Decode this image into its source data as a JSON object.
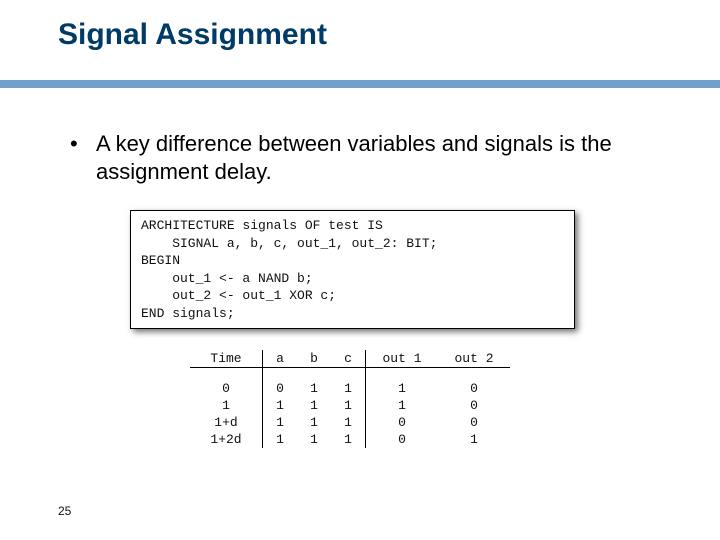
{
  "title": "Signal Assignment",
  "bullet_text": "A key difference between variables and signals is the assignment delay.",
  "code": {
    "l1": "ARCHITECTURE signals OF test IS",
    "l2": "    SIGNAL a, b, c, out_1, out_2: BIT;",
    "l3": "BEGIN",
    "l4": "    out_1 <- a NAND b;",
    "l5": "    out_2 <- out_1 XOR c;",
    "l6": "END signals;"
  },
  "table": {
    "headers": {
      "time": "Time",
      "a": "a",
      "b": "b",
      "c": "c",
      "out1": "out 1",
      "out2": "out 2"
    },
    "rows": [
      {
        "time": "0",
        "a": "0",
        "b": "1",
        "c": "1",
        "out1": "1",
        "out2": "0"
      },
      {
        "time": "1",
        "a": "1",
        "b": "1",
        "c": "1",
        "out1": "1",
        "out2": "0"
      },
      {
        "time": "1+d",
        "a": "1",
        "b": "1",
        "c": "1",
        "out1": "0",
        "out2": "0"
      },
      {
        "time": "1+2d",
        "a": "1",
        "b": "1",
        "c": "1",
        "out1": "0",
        "out2": "1"
      }
    ]
  },
  "page_number": "25"
}
